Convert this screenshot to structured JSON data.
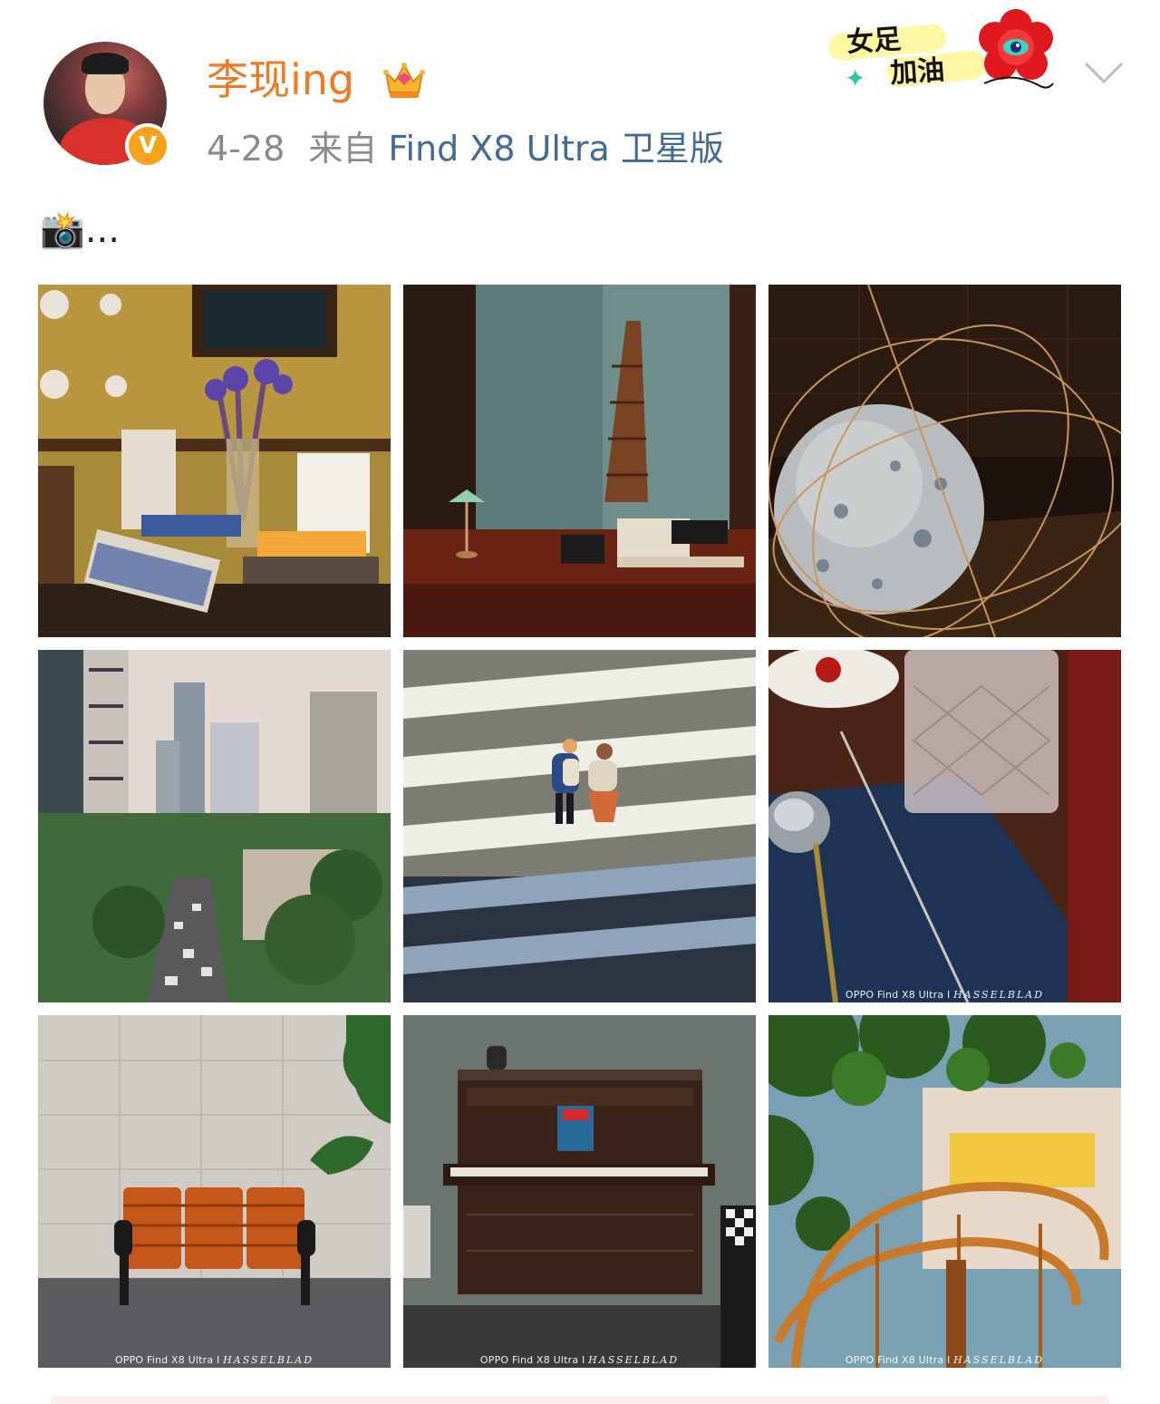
{
  "post": {
    "author": {
      "name": "李现ing",
      "verified_mark": "V",
      "badge_icon": "crown-icon"
    },
    "meta": {
      "date": "4-28",
      "source_prefix": "来自",
      "source_device": "Find X8 Ultra 卫星版"
    },
    "sticker": {
      "line1": "女足",
      "line2": "加油"
    },
    "more_icon": "chevron-down-icon",
    "text": {
      "emoji": "📸",
      "body": "..."
    },
    "photos": [
      {
        "subject": "bookshelf-with-irises",
        "watermark": ""
      },
      {
        "subject": "desk-with-lamp",
        "watermark": ""
      },
      {
        "subject": "paper-globe-sculpture",
        "watermark": ""
      },
      {
        "subject": "city-skyline-street",
        "watermark": ""
      },
      {
        "subject": "couple-on-crosswalk",
        "watermark": ""
      },
      {
        "subject": "crystal-glass-and-spoon",
        "watermark": "OPPO Find X8 Ultra I ",
        "watermark_brand": "HASSELBLAD"
      },
      {
        "subject": "orange-bench",
        "watermark": "OPPO Find X8 Ultra I ",
        "watermark_brand": "HASSELBLAD"
      },
      {
        "subject": "vintage-piano",
        "watermark": "OPPO Find X8 Ultra I ",
        "watermark_brand": "HASSELBLAD"
      },
      {
        "subject": "spiral-staircase-tree",
        "watermark": "OPPO Find X8 Ultra I ",
        "watermark_brand": "HASSELBLAD"
      }
    ]
  },
  "colors": {
    "username": "#f07a24",
    "source_link": "#436a94",
    "meta_gray": "#8a8a8a",
    "verified_badge": "#f6a21b"
  }
}
